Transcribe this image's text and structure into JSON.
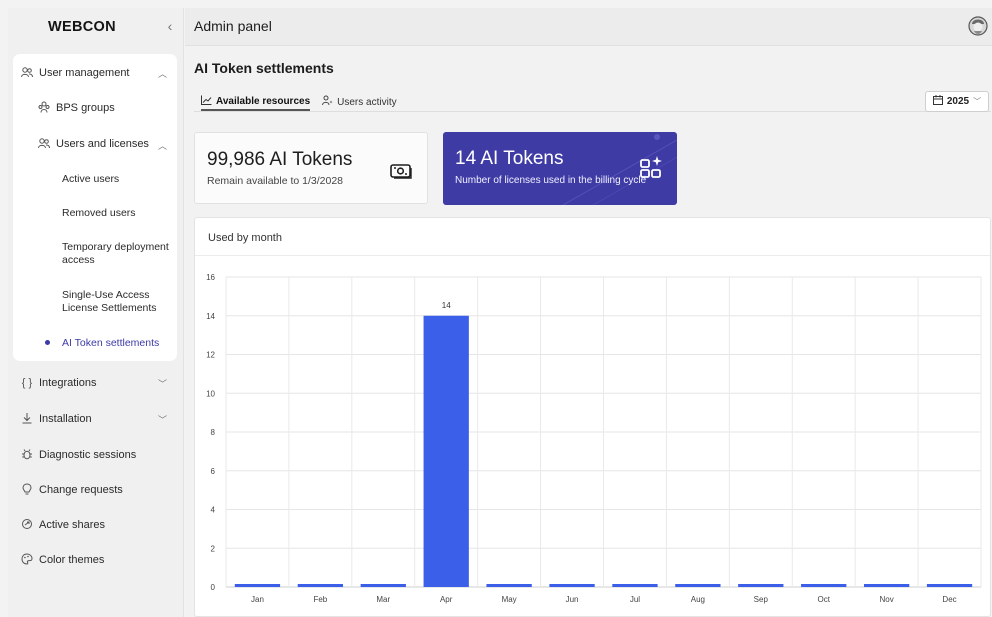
{
  "sidebar": {
    "logo": "WEBCON",
    "collapse_glyph": "‹",
    "user_management": {
      "label": "User management"
    },
    "bps_groups": {
      "label": "BPS groups"
    },
    "users_and_licenses": {
      "label": "Users and licenses"
    },
    "sub_items": [
      {
        "label": "Active users"
      },
      {
        "label": "Removed users"
      },
      {
        "label": "Temporary deployment access"
      },
      {
        "label": "Single-Use Access License Settlements"
      },
      {
        "label": "AI Token settlements"
      }
    ],
    "integrations": {
      "label": "Integrations"
    },
    "installation": {
      "label": "Installation"
    },
    "diagnostic_sessions": {
      "label": "Diagnostic sessions"
    },
    "change_requests": {
      "label": "Change requests"
    },
    "active_shares": {
      "label": "Active shares"
    },
    "color_themes": {
      "label": "Color themes"
    }
  },
  "topbar": {
    "title": "Admin panel"
  },
  "main": {
    "page_title": "AI Token settlements",
    "tabs": [
      {
        "label": "Available resources",
        "icon": "line-chart-icon"
      },
      {
        "label": "Users activity",
        "icon": "person-sparkle-icon"
      }
    ],
    "year": "2025",
    "card_tokens": {
      "value": "99,986 AI Tokens",
      "caption": "Remain available to 1/3/2028"
    },
    "card_licenses": {
      "value": "14 AI Tokens",
      "caption": "Number of licenses used in the billing cycle"
    },
    "chart_title": "Used by month"
  },
  "colors": {
    "accent": "#3f3ba5",
    "bar": "#3b5fe8",
    "active_nav": "#3d3aa6"
  },
  "chart_data": {
    "type": "bar",
    "title": "",
    "categories": [
      "Jan",
      "Feb",
      "Mar",
      "Apr",
      "May",
      "Jun",
      "Jul",
      "Aug",
      "Sep",
      "Oct",
      "Nov",
      "Dec"
    ],
    "values": [
      0,
      0,
      0,
      14,
      0,
      0,
      0,
      0,
      0,
      0,
      0,
      0
    ],
    "data_labels": {
      "Apr": "14"
    },
    "yticks": [
      0,
      2,
      4,
      6,
      8,
      10,
      12,
      14,
      16
    ],
    "ylim": [
      0,
      16
    ],
    "xlabel": "",
    "ylabel": "",
    "grid": true,
    "legend": "none"
  }
}
